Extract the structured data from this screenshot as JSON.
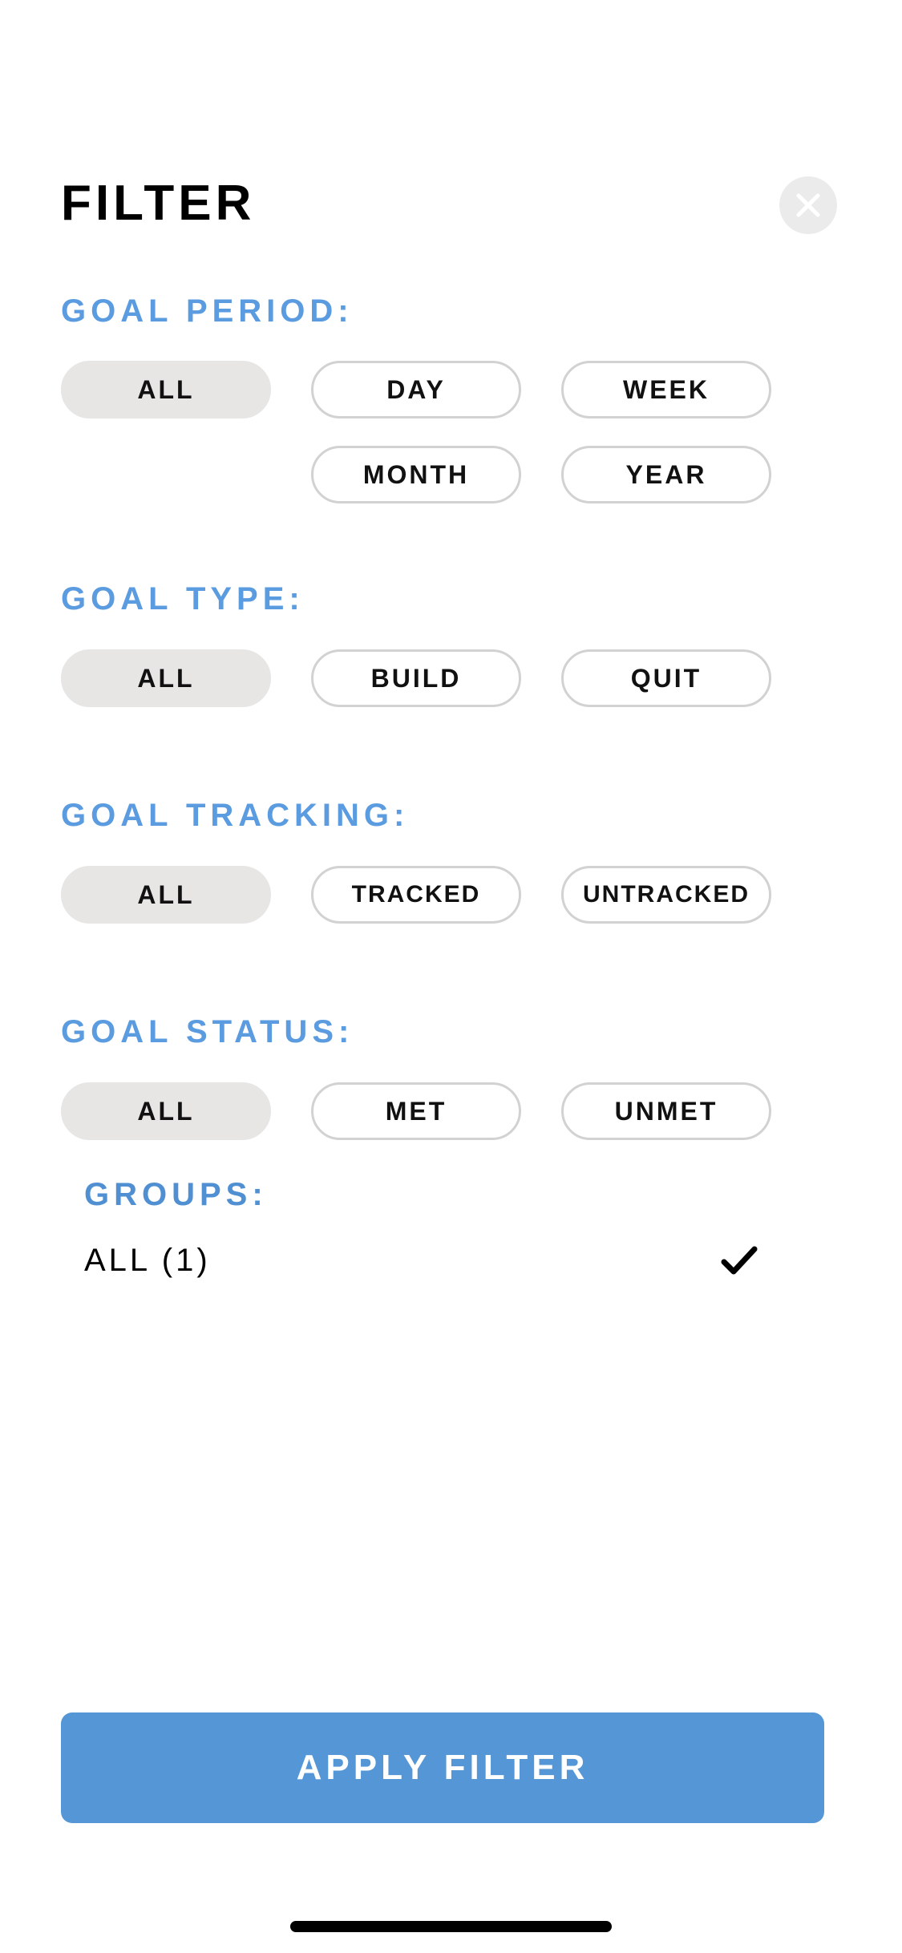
{
  "header": {
    "title": "FILTER",
    "close_icon": "close-x-icon"
  },
  "goal_period": {
    "label": "GOAL PERIOD:",
    "options": [
      "ALL",
      "DAY",
      "WEEK",
      "MONTH",
      "YEAR"
    ],
    "selected": "ALL"
  },
  "goal_type": {
    "label": "GOAL TYPE:",
    "options": [
      "ALL",
      "BUILD",
      "QUIT"
    ],
    "selected": "ALL"
  },
  "goal_tracking": {
    "label": "GOAL TRACKING:",
    "options": [
      "ALL",
      "TRACKED",
      "UNTRACKED"
    ],
    "selected": "ALL"
  },
  "goal_status": {
    "label": "GOAL STATUS:",
    "options": [
      "ALL",
      "MET",
      "UNMET"
    ],
    "selected": "ALL"
  },
  "groups": {
    "label": "GROUPS:",
    "items": [
      {
        "name": "ALL (1)",
        "checked": true,
        "icon": "checkmark-icon"
      }
    ]
  },
  "footer": {
    "apply_label": "APPLY FILTER"
  },
  "colors": {
    "accent": "#5496d6",
    "section_label": "#5b9be0",
    "chip_selected": "#e8e5e5",
    "chip_border": "#d2d2d2"
  }
}
